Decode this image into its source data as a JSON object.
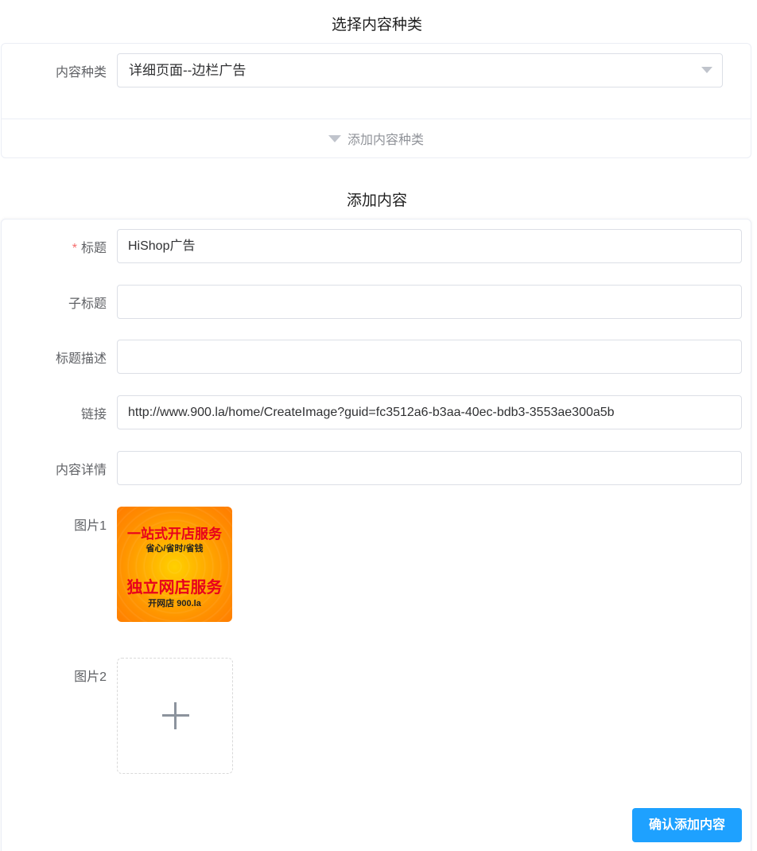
{
  "section_select": {
    "title": "选择内容种类",
    "type_label": "内容种类",
    "type_value": "详细页面--边栏广告",
    "add_type_label": "添加内容种类"
  },
  "section_add": {
    "title": "添加内容",
    "required_mark": "*",
    "fields": {
      "title_label": "标题",
      "title_value": "HiShop广告",
      "subtitle_label": "子标题",
      "subtitle_value": "",
      "desc_label": "标题描述",
      "desc_value": "",
      "link_label": "链接",
      "link_value": "http://www.900.la/home/CreateImage?guid=fc3512a6-b3aa-40ec-bdb3-3553ae300a5b",
      "detail_label": "内容详情",
      "detail_value": ""
    },
    "image1_label": "图片1",
    "image1_ad": {
      "line1": "一站式开店服务",
      "line2": "省心/省时/省钱",
      "line3": "独立网店服务",
      "line4": "开网店 900.la"
    },
    "image2_label": "图片2",
    "confirm_label": "确认添加内容"
  },
  "colors": {
    "primary": "#1ea1ff",
    "required": "#f56c6c",
    "border": "#dcdfe6"
  },
  "icons": [
    "caret-down-icon",
    "plus-icon"
  ]
}
